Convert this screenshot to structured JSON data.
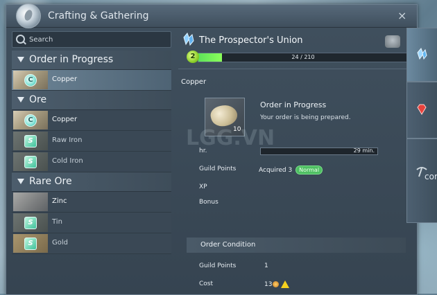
{
  "window": {
    "title": "Crafting & Gathering",
    "close_glyph": "×"
  },
  "search": {
    "placeholder": "Search"
  },
  "list": {
    "categories": [
      {
        "label": "Order in Progress",
        "items": [
          {
            "name": "Copper",
            "badge": "C",
            "selected": true
          }
        ]
      },
      {
        "label": "Ore",
        "items": [
          {
            "name": "Copper",
            "badge": "C"
          },
          {
            "name": "Raw Iron",
            "badge": "S"
          },
          {
            "name": "Cold Iron",
            "badge": "S"
          }
        ]
      },
      {
        "label": "Rare Ore",
        "items": [
          {
            "name": "Zinc"
          },
          {
            "name": "Tin",
            "badge": "S"
          },
          {
            "name": "Gold",
            "badge": "S"
          }
        ]
      }
    ]
  },
  "union": {
    "title": "The Prospector's Union",
    "level": "2",
    "progress_text": "24 / 210",
    "progress_fraction": 0.114
  },
  "detail": {
    "item_name": "Copper",
    "quantity": "10",
    "status_title": "Order in Progress",
    "status_sub": "Your order is being prepared.",
    "hr_label": "hr.",
    "time_left": "29 min.",
    "guild_points_label": "Guild Points",
    "acquired_text": "Acquired 3",
    "acquired_badge": "Normal",
    "xp_label": "XP",
    "bonus_label": "Bonus"
  },
  "condition": {
    "header": "Order Condition",
    "guild_points_label": "Guild Points",
    "guild_points_value": "1",
    "cost_label": "Cost",
    "cost_value": "13"
  },
  "side_tabs": {
    "partial_label": "cor"
  },
  "watermark": "LGG.VN",
  "colors": {
    "progress_fill": "#6cf05a",
    "level_badge": "#8ccf2a",
    "normal_pill": "#4fbf63",
    "warning": "#f5d11e"
  }
}
